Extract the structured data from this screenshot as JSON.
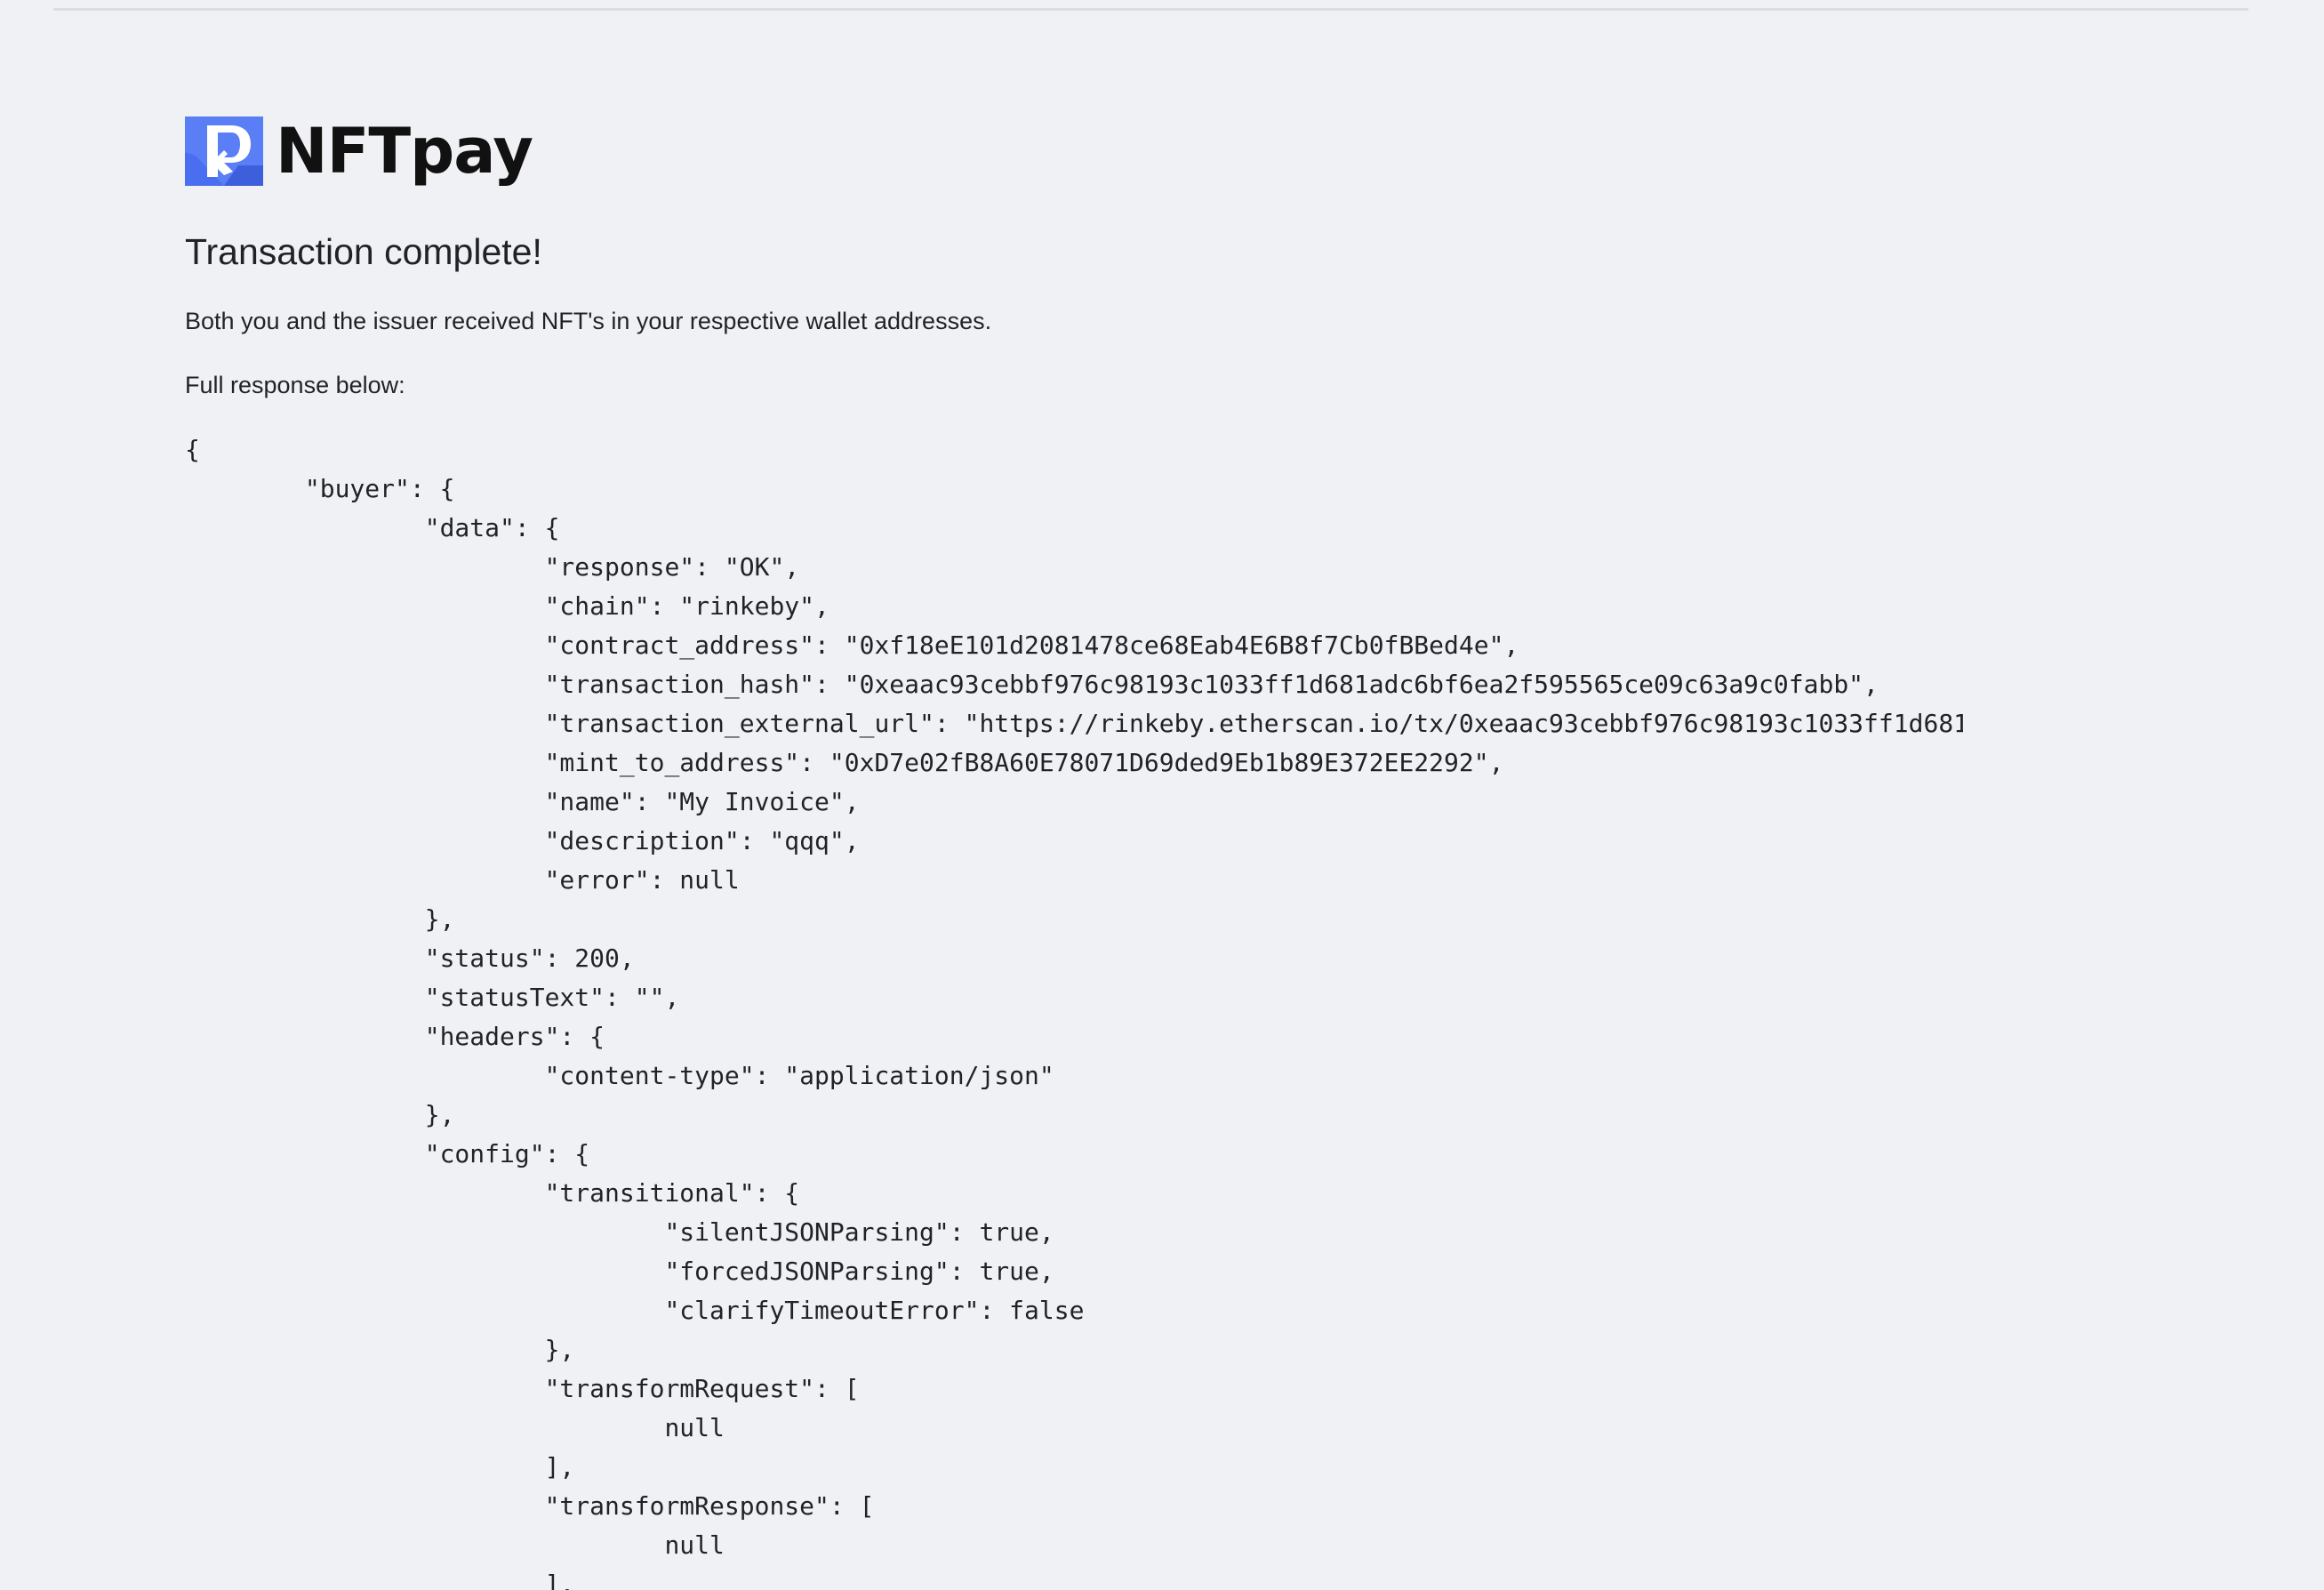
{
  "brand": {
    "name": "NFTpay",
    "logo_icon": "nftpay-logo-icon",
    "logo_color": "#4a6ef0"
  },
  "page": {
    "title": "Transaction complete!",
    "message": "Both you and the issuer received NFT's in your respective wallet addresses.",
    "response_label": "Full response below:"
  },
  "response_lines": [
    "{",
    "        \"buyer\": {",
    "                \"data\": {",
    "                        \"response\": \"OK\",",
    "                        \"chain\": \"rinkeby\",",
    "                        \"contract_address\": \"0xf18eE101d2081478ce68Eab4E6B8f7Cb0fBBed4e\",",
    "                        \"transaction_hash\": \"0xeaac93cebbf976c98193c1033ff1d681adc6bf6ea2f595565ce09c63a9c0fabb\",",
    "                        \"transaction_external_url\": \"https://rinkeby.etherscan.io/tx/0xeaac93cebbf976c98193c1033ff1d681",
    "                        \"mint_to_address\": \"0xD7e02fB8A60E78071D69ded9Eb1b89E372EE2292\",",
    "                        \"name\": \"My Invoice\",",
    "                        \"description\": \"qqq\",",
    "                        \"error\": null",
    "                },",
    "                \"status\": 200,",
    "                \"statusText\": \"\",",
    "                \"headers\": {",
    "                        \"content-type\": \"application/json\"",
    "                },",
    "                \"config\": {",
    "                        \"transitional\": {",
    "                                \"silentJSONParsing\": true,",
    "                                \"forcedJSONParsing\": true,",
    "                                \"clarifyTimeoutError\": false",
    "                        },",
    "                        \"transformRequest\": [",
    "                                null",
    "                        ],",
    "                        \"transformResponse\": [",
    "                                null",
    "                        ],"
  ]
}
